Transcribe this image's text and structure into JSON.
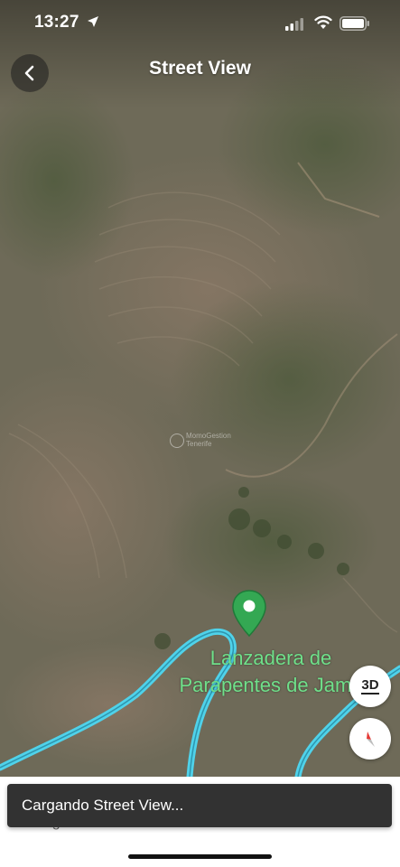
{
  "status_bar": {
    "time": "13:27"
  },
  "header": {
    "title": "Street View"
  },
  "map": {
    "watermark_line1": "MomoGestion",
    "watermark_line2": "Tenerife",
    "place_label_line1": "Lanzadera de",
    "place_label_line2": "Parapentes de Jama",
    "pin_color": "#34a853",
    "road_color": "#4fd2ea"
  },
  "controls": {
    "three_d_label": "3D"
  },
  "sheet": {
    "subtitle": "Lugar de interés histórico en La Escalona"
  },
  "toast": {
    "message": "Cargando Street View..."
  }
}
